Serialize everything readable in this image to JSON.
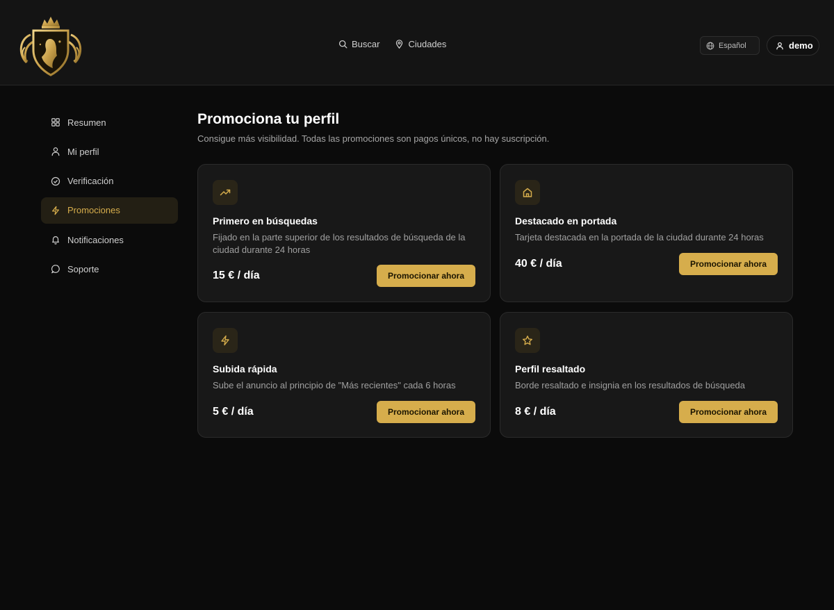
{
  "colors": {
    "accent": "#d6ad4c",
    "background": "#0b0b0b",
    "card": "#181818",
    "header": "#141414"
  },
  "header": {
    "logo_icon": "crest-logo-icon",
    "nav": [
      {
        "label": "Buscar",
        "icon": "search-icon"
      },
      {
        "label": "Ciudades",
        "icon": "map-pin-icon"
      }
    ],
    "language": {
      "label": "Español",
      "icon": "globe-icon"
    },
    "user": {
      "label": "demo",
      "icon": "user-icon"
    }
  },
  "sidebar": {
    "items": [
      {
        "label": "Resumen",
        "icon": "grid-icon"
      },
      {
        "label": "Mi perfil",
        "icon": "user-icon"
      },
      {
        "label": "Verificación",
        "icon": "check-circle-icon"
      },
      {
        "label": "Promociones",
        "icon": "bolt-icon",
        "active": true
      },
      {
        "label": "Notificaciones",
        "icon": "bell-icon"
      },
      {
        "label": "Soporte",
        "icon": "chat-icon"
      }
    ]
  },
  "main": {
    "title": "Promociona tu perfil",
    "subtitle": "Consigue más visibilidad. Todas las promociones son pagos únicos, no hay suscripción.",
    "cards": [
      {
        "icon": "trending-up-icon",
        "title": "Primero en búsquedas",
        "description": "Fijado en la parte superior de los resultados de búsqueda de la ciudad durante 24 horas",
        "price": "15 € / día",
        "button": "Promocionar ahora"
      },
      {
        "icon": "home-icon",
        "title": "Destacado en portada",
        "description": "Tarjeta destacada en la portada de la ciudad durante 24 horas",
        "price": "40 € / día",
        "button": "Promocionar ahora"
      },
      {
        "icon": "bolt-icon",
        "title": "Subida rápida",
        "description": "Sube el anuncio al principio de \"Más recientes\" cada 6 horas",
        "price": "5 € / día",
        "button": "Promocionar ahora"
      },
      {
        "icon": "star-icon",
        "title": "Perfil resaltado",
        "description": "Borde resaltado e insignia en los resultados de búsqueda",
        "price": "8 € / día",
        "button": "Promocionar ahora"
      }
    ]
  }
}
